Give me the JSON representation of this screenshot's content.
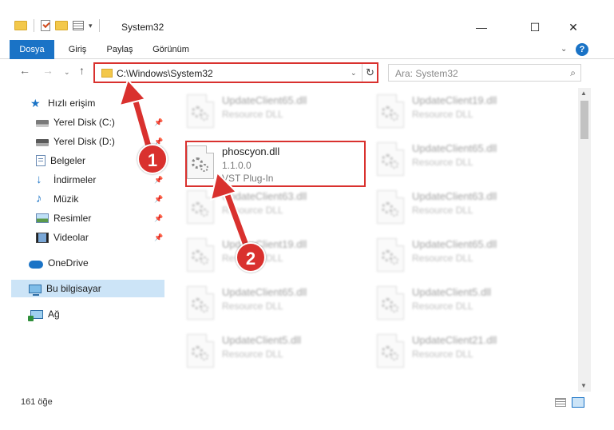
{
  "window": {
    "title": "System32",
    "minimize_icon": "minimize-icon",
    "maximize_icon": "maximize-icon",
    "close_icon": "close-icon"
  },
  "ribbon": {
    "tabs": [
      {
        "label": "Dosya"
      },
      {
        "label": "Giriş"
      },
      {
        "label": "Paylaş"
      },
      {
        "label": "Görünüm"
      }
    ],
    "help": "?"
  },
  "nav": {
    "address": "C:\\Windows\\System32",
    "search_placeholder": "Ara: System32"
  },
  "sidebar": {
    "items": [
      {
        "label": "Hızlı erişim",
        "icon": "star-icon"
      },
      {
        "label": "Yerel Disk (C:)",
        "icon": "drive-icon"
      },
      {
        "label": "Yerel Disk (D:)",
        "icon": "drive-icon"
      },
      {
        "label": "Belgeler",
        "icon": "documents-icon"
      },
      {
        "label": "İndirmeler",
        "icon": "download-icon"
      },
      {
        "label": "Müzik",
        "icon": "music-icon"
      },
      {
        "label": "Resimler",
        "icon": "pictures-icon"
      },
      {
        "label": "Videolar",
        "icon": "video-icon"
      },
      {
        "label": "OneDrive",
        "icon": "cloud-icon"
      },
      {
        "label": "Bu bilgisayar",
        "icon": "computer-icon"
      },
      {
        "label": "Ağ",
        "icon": "network-icon"
      }
    ]
  },
  "files": {
    "target": {
      "name": "phoscyon.dll",
      "version": "1.1.0.0",
      "type": "VST Plug-In"
    },
    "others": [
      {
        "name": "UpdateClient65.dll",
        "type": "Resource DLL"
      },
      {
        "name": "UpdateClient19.dll",
        "type": "Resource DLL"
      },
      {
        "name": "UpdateClient65.dll",
        "type": "Resource DLL"
      },
      {
        "name": "UpdateClient63.dll",
        "type": "Resource DLL"
      },
      {
        "name": "UpdateClient63.dll",
        "type": "Resource DLL"
      },
      {
        "name": "UpdateClient19.dll",
        "type": "Resource DLL"
      },
      {
        "name": "UpdateClient65.dll",
        "type": "Resource DLL"
      },
      {
        "name": "UpdateClient65.dll",
        "type": "Resource DLL"
      },
      {
        "name": "UpdateClient5.dll",
        "type": "Resource DLL"
      },
      {
        "name": "UpdateClient5.dll",
        "type": "Resource DLL"
      },
      {
        "name": "UpdateClient21.dll",
        "type": "Resource DLL"
      }
    ]
  },
  "status": {
    "count": "161 öğe"
  },
  "annotations": {
    "badge1": "1",
    "badge2": "2",
    "color": "#d9312e"
  }
}
